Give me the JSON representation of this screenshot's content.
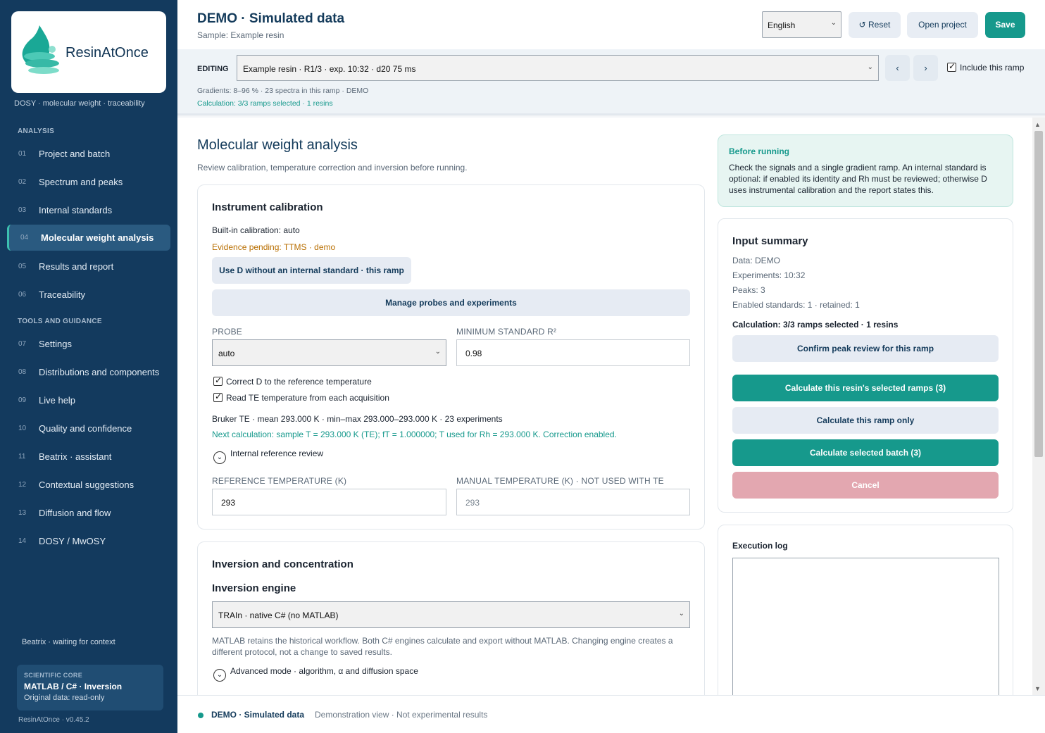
{
  "sidebar": {
    "logo_text": "ResinAtOnce",
    "tagline": "DOSY · molecular weight · traceability",
    "section_analysis": "ANALYSIS",
    "section_tools": "TOOLS AND GUIDANCE",
    "items": [
      {
        "num": "01",
        "label": "Project and batch"
      },
      {
        "num": "02",
        "label": "Spectrum and peaks"
      },
      {
        "num": "03",
        "label": "Internal standards"
      },
      {
        "num": "04",
        "label": "Molecular weight analysis"
      },
      {
        "num": "05",
        "label": "Results and report"
      },
      {
        "num": "06",
        "label": "Traceability"
      },
      {
        "num": "07",
        "label": "Settings"
      },
      {
        "num": "08",
        "label": "Distributions and components"
      },
      {
        "num": "09",
        "label": "Live help"
      },
      {
        "num": "10",
        "label": "Quality and confidence"
      },
      {
        "num": "11",
        "label": "Beatrix · assistant"
      },
      {
        "num": "12",
        "label": "Contextual suggestions"
      },
      {
        "num": "13",
        "label": "Diffusion and flow"
      },
      {
        "num": "14",
        "label": "DOSY / MwOSY"
      }
    ],
    "active_index": 3,
    "beatrix_status": "Beatrix · waiting for context",
    "core": {
      "title": "SCIENTIFIC CORE",
      "name": "MATLAB / C# · Inversion",
      "sub": "Original data: read-only"
    },
    "version": "ResinAtOnce · v0.45.2",
    "colors": {
      "bg": "#133a5e",
      "accent": "#3cc0b0"
    }
  },
  "header": {
    "title": "DEMO · Simulated data",
    "subtitle": "Sample: Example resin",
    "language": "English",
    "reset_label": "↺ Reset",
    "open_label": "Open project",
    "save_label": "Save"
  },
  "editing": {
    "label": "EDITING",
    "ramp": "Example resin · R1/3 · exp. 10:32 · d20 75 ms",
    "prev": "‹",
    "next": "›",
    "include_label": "Include this ramp",
    "info": "Gradients: 8–96 % · 23 spectra in this ramp · DEMO",
    "calc": "Calculation: 3/3 ramps selected · 1 resins"
  },
  "main": {
    "title": "Molecular weight analysis",
    "subtitle": "Review calibration, temperature correction and inversion before running."
  },
  "calibration": {
    "title": "Instrument calibration",
    "builtin": "Built-in calibration: auto",
    "evidence": "Evidence pending: TTMS · demo",
    "use_d_button": "Use D without an internal standard · this ramp",
    "manage_button": "Manage probes and experiments",
    "probe_label": "PROBE",
    "probe_value": "auto",
    "min_r2_label": "MINIMUM STANDARD R²",
    "min_r2_value": "0.98",
    "correct_d_label": "Correct D to the reference temperature",
    "read_te_label": "Read TE temperature from each acquisition",
    "bruker_te": "Bruker TE · mean 293.000 K · min–max 293.000–293.000 K · 23 experiments",
    "next_calc": "Next calculation: sample T = 293.000 K (TE); fT = 1.000000; T used for Rh = 293.000 K. Correction enabled.",
    "internal_review": "Internal reference review",
    "ref_temp_label": "REFERENCE TEMPERATURE (K)",
    "ref_temp_value": "293",
    "manual_temp_label": "MANUAL TEMPERATURE (K) · NOT USED WITH TE",
    "manual_temp_value": "293"
  },
  "inversion": {
    "title": "Inversion and concentration",
    "engine_title": "Inversion engine",
    "engine_value": "TRAIn · native C# (no MATLAB)",
    "note": "MATLAB retains the historical workflow. Both C# engines calculate and export without MATLAB. Changing engine creates a different protocol, not a change to saved results.",
    "advanced": "Advanced mode · algorithm, α and diffusion space"
  },
  "before": {
    "title": "Before running",
    "body": "Check the signals and a single gradient ramp. An internal standard is optional: if enabled its identity and Rh must be reviewed; otherwise D uses instrumental calibration and the report states this."
  },
  "summary": {
    "title": "Input summary",
    "data": "Data: DEMO",
    "experiments": "Experiments: 10:32",
    "peaks": "Peaks: 3",
    "standards": "Enabled standards: 1 · retained: 1",
    "calc": "Calculation: 3/3 ramps selected · 1 resins",
    "confirm_button": "Confirm peak review for this ramp",
    "calc_resin_button": "Calculate this resin's selected ramps (3)",
    "calc_ramp_button": "Calculate this ramp only",
    "calc_batch_button": "Calculate selected batch (3)",
    "cancel_button": "Cancel"
  },
  "log": {
    "title": "Execution log"
  },
  "footer": {
    "status": "DEMO · Simulated data",
    "note": "Demonstration view · Not experimental results"
  },
  "colors": {
    "teal": "#16998c",
    "navy": "#143b5b",
    "warning": "#b86e00",
    "cancel": "#e3a7b0"
  }
}
